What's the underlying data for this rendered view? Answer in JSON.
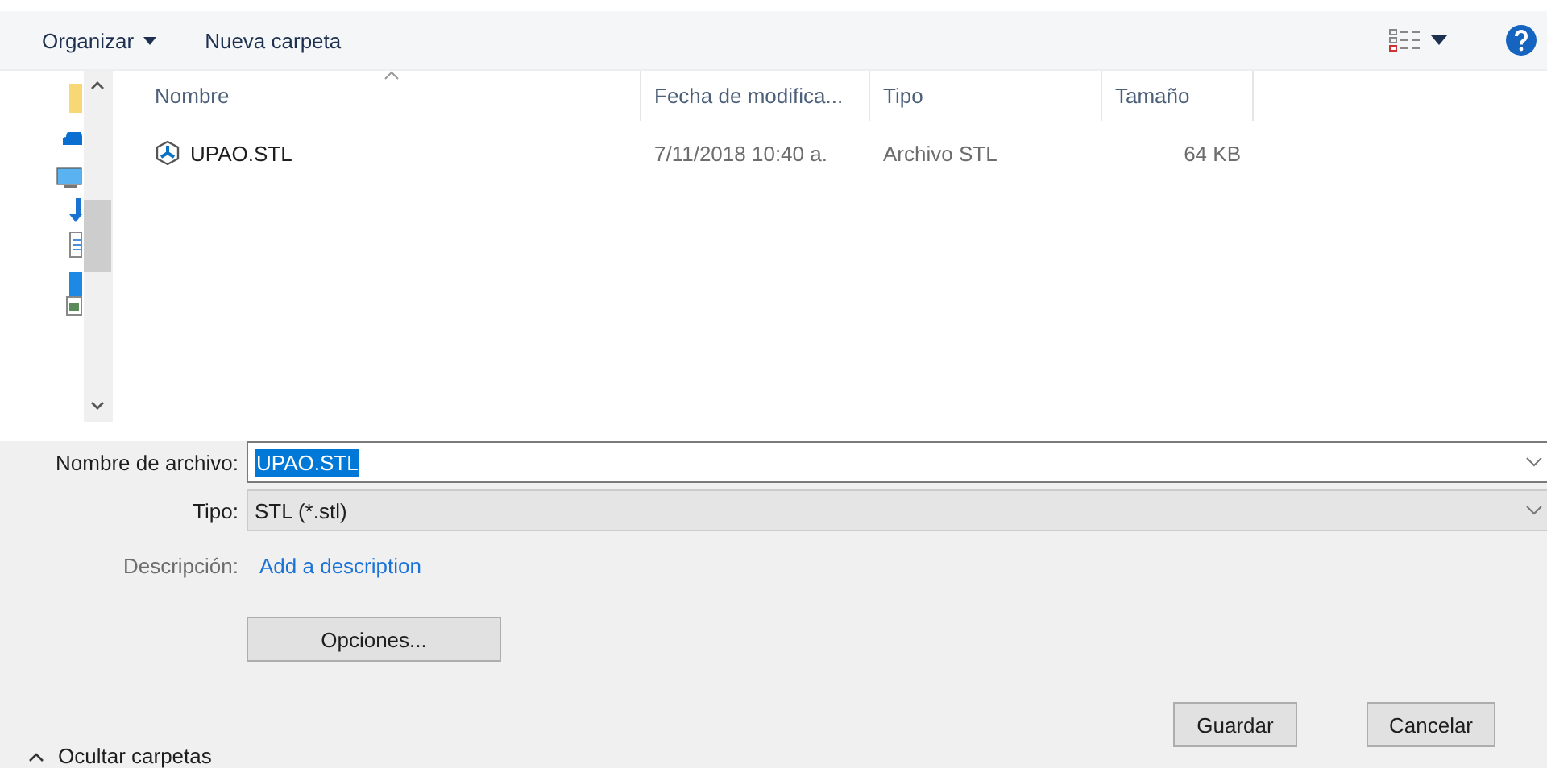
{
  "toolbar": {
    "buttons": [
      {
        "label": "Organizar",
        "dropdown": true
      },
      {
        "label": "Nueva carpeta",
        "dropdown": false
      }
    ]
  },
  "file_list": {
    "columns": [
      {
        "label": "Nombre",
        "sorted": true
      },
      {
        "label": "Fecha de modifica...",
        "sorted": false
      },
      {
        "label": "Tipo",
        "sorted": false
      },
      {
        "label": "Tamaño",
        "sorted": false
      }
    ],
    "rows": [
      {
        "name": "UPAO.STL",
        "modified": "7/11/2018 10:40 a.",
        "type": "Archivo STL",
        "size": "64 KB",
        "selected": false
      }
    ]
  },
  "form": {
    "file_name": {
      "label": "Nombre de archivo:",
      "value": "UPAO.STL",
      "text_selected": true
    },
    "file_type": {
      "label": "Tipo:",
      "value": "STL (*.stl)"
    },
    "description": {
      "label": "Descripción:",
      "link": "Add a description"
    },
    "options_button": "Opciones...",
    "hide_folders": "Ocultar carpetas",
    "buttons": [
      "Guardar",
      "Cancelar"
    ]
  }
}
